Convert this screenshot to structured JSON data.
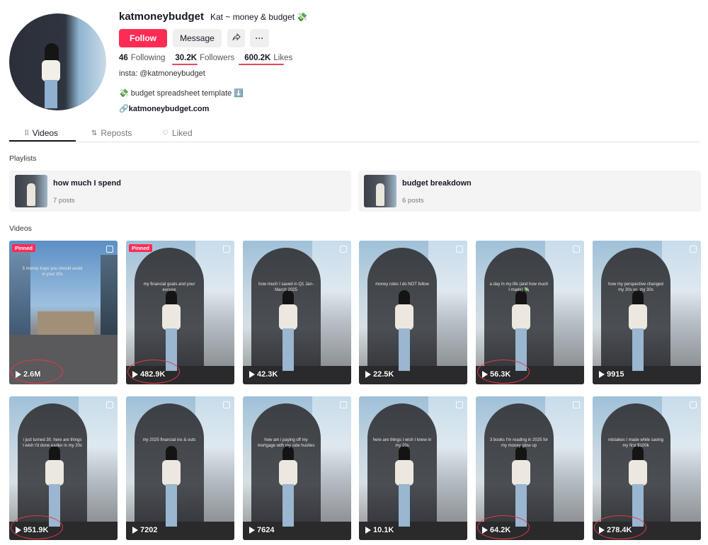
{
  "profile": {
    "username": "katmoneybudget",
    "nickname": "Kat ~ money & budget 💸",
    "follow_label": "Follow",
    "message_label": "Message",
    "share_icon": "share-icon",
    "more_label": "···",
    "stats": [
      {
        "count": "46",
        "label": "Following"
      },
      {
        "count": "30.2K",
        "label": "Followers"
      },
      {
        "count": "600.2K",
        "label": "Likes"
      }
    ],
    "bio_line1": "insta: @katmoneybudget",
    "bio_line2": "💸 budget spreadsheet template ⬇️",
    "link": "katmoneybudget.com"
  },
  "tabs": [
    {
      "label": "Videos",
      "icon": "grid-icon",
      "active": true
    },
    {
      "label": "Reposts",
      "icon": "repost-icon",
      "active": false
    },
    {
      "label": "Liked",
      "icon": "heart-icon",
      "active": false
    }
  ],
  "playlists_label": "Playlists",
  "playlists": [
    {
      "title": "how much I spend",
      "count": "7 posts"
    },
    {
      "title": "budget breakdown",
      "count": "6 posts"
    }
  ],
  "videos_label": "Videos",
  "pinned_label": "Pinned",
  "videos": [
    {
      "views": "2.6M",
      "pinned": true,
      "circled": true,
      "caption": "5 money traps you should avoid in your 20s",
      "scene": "street"
    },
    {
      "views": "482.9K",
      "pinned": true,
      "circled": true,
      "caption": "my financial goals and your excuse",
      "scene": "arch"
    },
    {
      "views": "42.3K",
      "pinned": false,
      "circled": false,
      "caption": "how much I saved in Q1 Jan-March 2025",
      "scene": "arch"
    },
    {
      "views": "22.5K",
      "pinned": false,
      "circled": false,
      "caption": "money rules I do NOT follow",
      "scene": "arch"
    },
    {
      "views": "56.3K",
      "pinned": false,
      "circled": true,
      "caption": "a day in my life (and how much I made) 💸",
      "scene": "arch"
    },
    {
      "views": "9915",
      "pinned": false,
      "circled": false,
      "caption": "how my perspective changed my 20s vs. my 30s",
      "scene": "arch"
    },
    {
      "views": "951.9K",
      "pinned": false,
      "circled": true,
      "caption": "i just turned 30. here are things I wish I'd done earlier in my 20s",
      "scene": "arch"
    },
    {
      "views": "7202",
      "pinned": false,
      "circled": false,
      "caption": "my 2025 financial ins & outs",
      "scene": "arch"
    },
    {
      "views": "7624",
      "pinned": false,
      "circled": false,
      "caption": "how am i paying off my mortgage with my side hustles",
      "scene": "arch"
    },
    {
      "views": "10.1K",
      "pinned": false,
      "circled": false,
      "caption": "here are things I wish I knew in my 20s",
      "scene": "arch"
    },
    {
      "views": "64.2K",
      "pinned": false,
      "circled": true,
      "caption": "3 books I'm reading in 2025 for my money glow up",
      "scene": "arch"
    },
    {
      "views": "278.4K",
      "pinned": false,
      "circled": true,
      "caption": "mistakes I made while saving my first $100k",
      "scene": "arch"
    }
  ]
}
